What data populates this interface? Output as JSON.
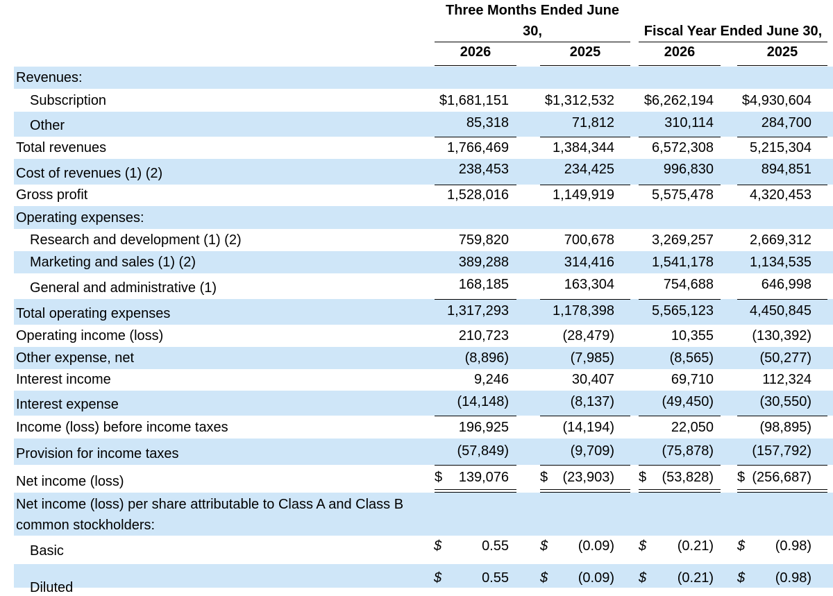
{
  "header": {
    "three_months": "Three Months Ended June 30,",
    "fiscal_year": "Fiscal Year Ended June 30,",
    "years": [
      "2026",
      "2025",
      "2026",
      "2025"
    ]
  },
  "rows": [
    {
      "label": "Revenues:",
      "values": [
        "",
        "",
        "",
        ""
      ]
    },
    {
      "label": "Subscription",
      "values": [
        "$1,681,151",
        "$1,312,532",
        "$6,262,194",
        "$4,930,604"
      ]
    },
    {
      "label": "Other",
      "values": [
        "85,318",
        "71,812",
        "310,114",
        "284,700"
      ]
    },
    {
      "label": "Total revenues",
      "values": [
        "1,766,469",
        "1,384,344",
        "6,572,308",
        "5,215,304"
      ]
    },
    {
      "label": "Cost of revenues (1) (2)",
      "values": [
        "238,453",
        "234,425",
        "996,830",
        "894,851"
      ]
    },
    {
      "label": "Gross profit",
      "values": [
        "1,528,016",
        "1,149,919",
        "5,575,478",
        "4,320,453"
      ]
    },
    {
      "label": "Operating expenses:",
      "values": [
        "",
        "",
        "",
        ""
      ]
    },
    {
      "label": "Research and development (1) (2)",
      "values": [
        "759,820",
        "700,678",
        "3,269,257",
        "2,669,312"
      ]
    },
    {
      "label": "Marketing and sales (1) (2)",
      "values": [
        "389,288",
        "314,416",
        "1,541,178",
        "1,134,535"
      ]
    },
    {
      "label": "General and administrative (1)",
      "values": [
        "168,185",
        "163,304",
        "754,688",
        "646,998"
      ]
    },
    {
      "label": "Total operating expenses",
      "values": [
        "1,317,293",
        "1,178,398",
        "5,565,123",
        "4,450,845"
      ]
    },
    {
      "label": "Operating income (loss)",
      "values": [
        "210,723",
        "(28,479)",
        "10,355",
        "(130,392)"
      ]
    },
    {
      "label": "Other expense, net",
      "values": [
        "(8,896)",
        "(7,985)",
        "(8,565)",
        "(50,277)"
      ]
    },
    {
      "label": "Interest income",
      "values": [
        "9,246",
        "30,407",
        "69,710",
        "112,324"
      ]
    },
    {
      "label": "Interest expense",
      "values": [
        "(14,148)",
        "(8,137)",
        "(49,450)",
        "(30,550)"
      ]
    },
    {
      "label": "Income (loss) before income taxes",
      "values": [
        "196,925",
        "(14,194)",
        "22,050",
        "(98,895)"
      ]
    },
    {
      "label": "Provision for income taxes",
      "values": [
        "(57,849)",
        "(9,709)",
        "(75,878)",
        "(157,792)"
      ]
    },
    {
      "label": "Net income (loss)",
      "values": [
        "139,076",
        "(23,903)",
        "(53,828)",
        "(256,687)"
      ],
      "currency": "$"
    },
    {
      "label": "Net income (loss) per share attributable to Class A and Class B common stockholders:",
      "values": [
        "",
        "",
        "",
        ""
      ]
    },
    {
      "label": "Basic",
      "values": [
        "0.55",
        "(0.09)",
        "(0.21)",
        "(0.98)"
      ],
      "currency": "$"
    },
    {
      "label": "Diluted",
      "values": [
        "0.55",
        "(0.09)",
        "(0.21)",
        "(0.98)"
      ],
      "currency": "$"
    }
  ],
  "colors": {
    "shade": "#cfe6f8",
    "text": "#000000"
  }
}
